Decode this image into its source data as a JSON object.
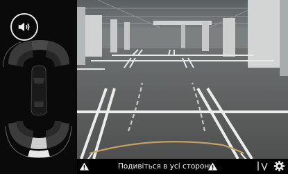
{
  "warning": {
    "text": "Подивіться в усі сторони"
  },
  "controls": {
    "volume_icon": "speaker-icon",
    "settings_icon": "gear-icon",
    "view_icon": "camera-view-icon"
  },
  "colors": {
    "warning_bar": "#000000",
    "sensor_active": "#e8e8e8",
    "guide_line": "#c4a064"
  }
}
